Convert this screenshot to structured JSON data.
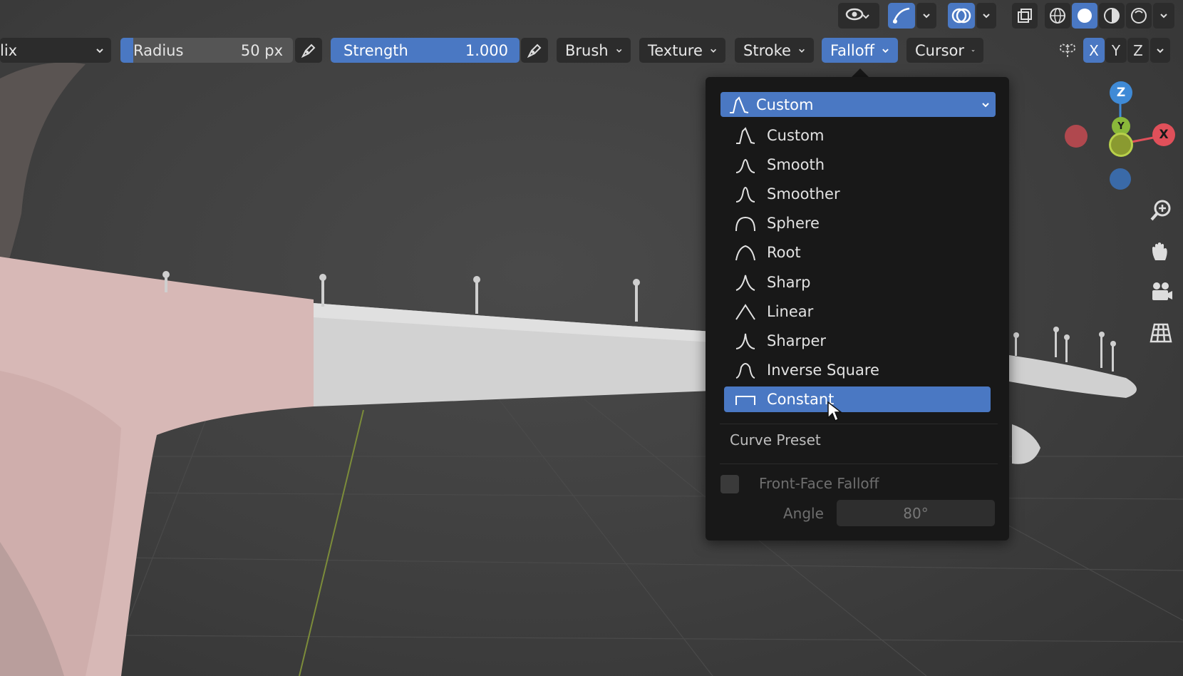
{
  "header": {
    "mode_label": "lix",
    "radius": {
      "label": "Radius",
      "value": "50 px"
    },
    "strength": {
      "label": "Strength",
      "value": "1.000"
    },
    "menus": [
      {
        "label": "Brush"
      },
      {
        "label": "Texture"
      },
      {
        "label": "Stroke"
      },
      {
        "label": "Falloff",
        "active": true
      },
      {
        "label": "Cursor"
      }
    ],
    "axes": [
      "X",
      "Y",
      "Z"
    ]
  },
  "falloff_dropdown": {
    "selected": "Custom",
    "items": [
      {
        "label": "Custom",
        "icon": "custom-curve-icon"
      },
      {
        "label": "Smooth",
        "icon": "smooth-curve-icon"
      },
      {
        "label": "Smoother",
        "icon": "smoother-curve-icon"
      },
      {
        "label": "Sphere",
        "icon": "sphere-curve-icon"
      },
      {
        "label": "Root",
        "icon": "root-curve-icon"
      },
      {
        "label": "Sharp",
        "icon": "sharp-curve-icon"
      },
      {
        "label": "Linear",
        "icon": "linear-curve-icon"
      },
      {
        "label": "Sharper",
        "icon": "sharper-curve-icon"
      },
      {
        "label": "Inverse Square",
        "icon": "inverse-square-curve-icon"
      },
      {
        "label": "Constant",
        "icon": "constant-curve-icon",
        "highlighted": true
      }
    ],
    "curve_preset_label": "Curve Preset",
    "front_face_falloff": {
      "label": "Front-Face Falloff",
      "checked": false
    },
    "angle": {
      "label": "Angle",
      "value": "80°"
    }
  },
  "gizmo": {
    "x": "X",
    "y": "Y",
    "z": "Z"
  },
  "colors": {
    "accent": "#4a78c3",
    "x_axis": "#e0505a",
    "y_axis": "#8ab83a",
    "z_axis": "#3f8ad6"
  }
}
